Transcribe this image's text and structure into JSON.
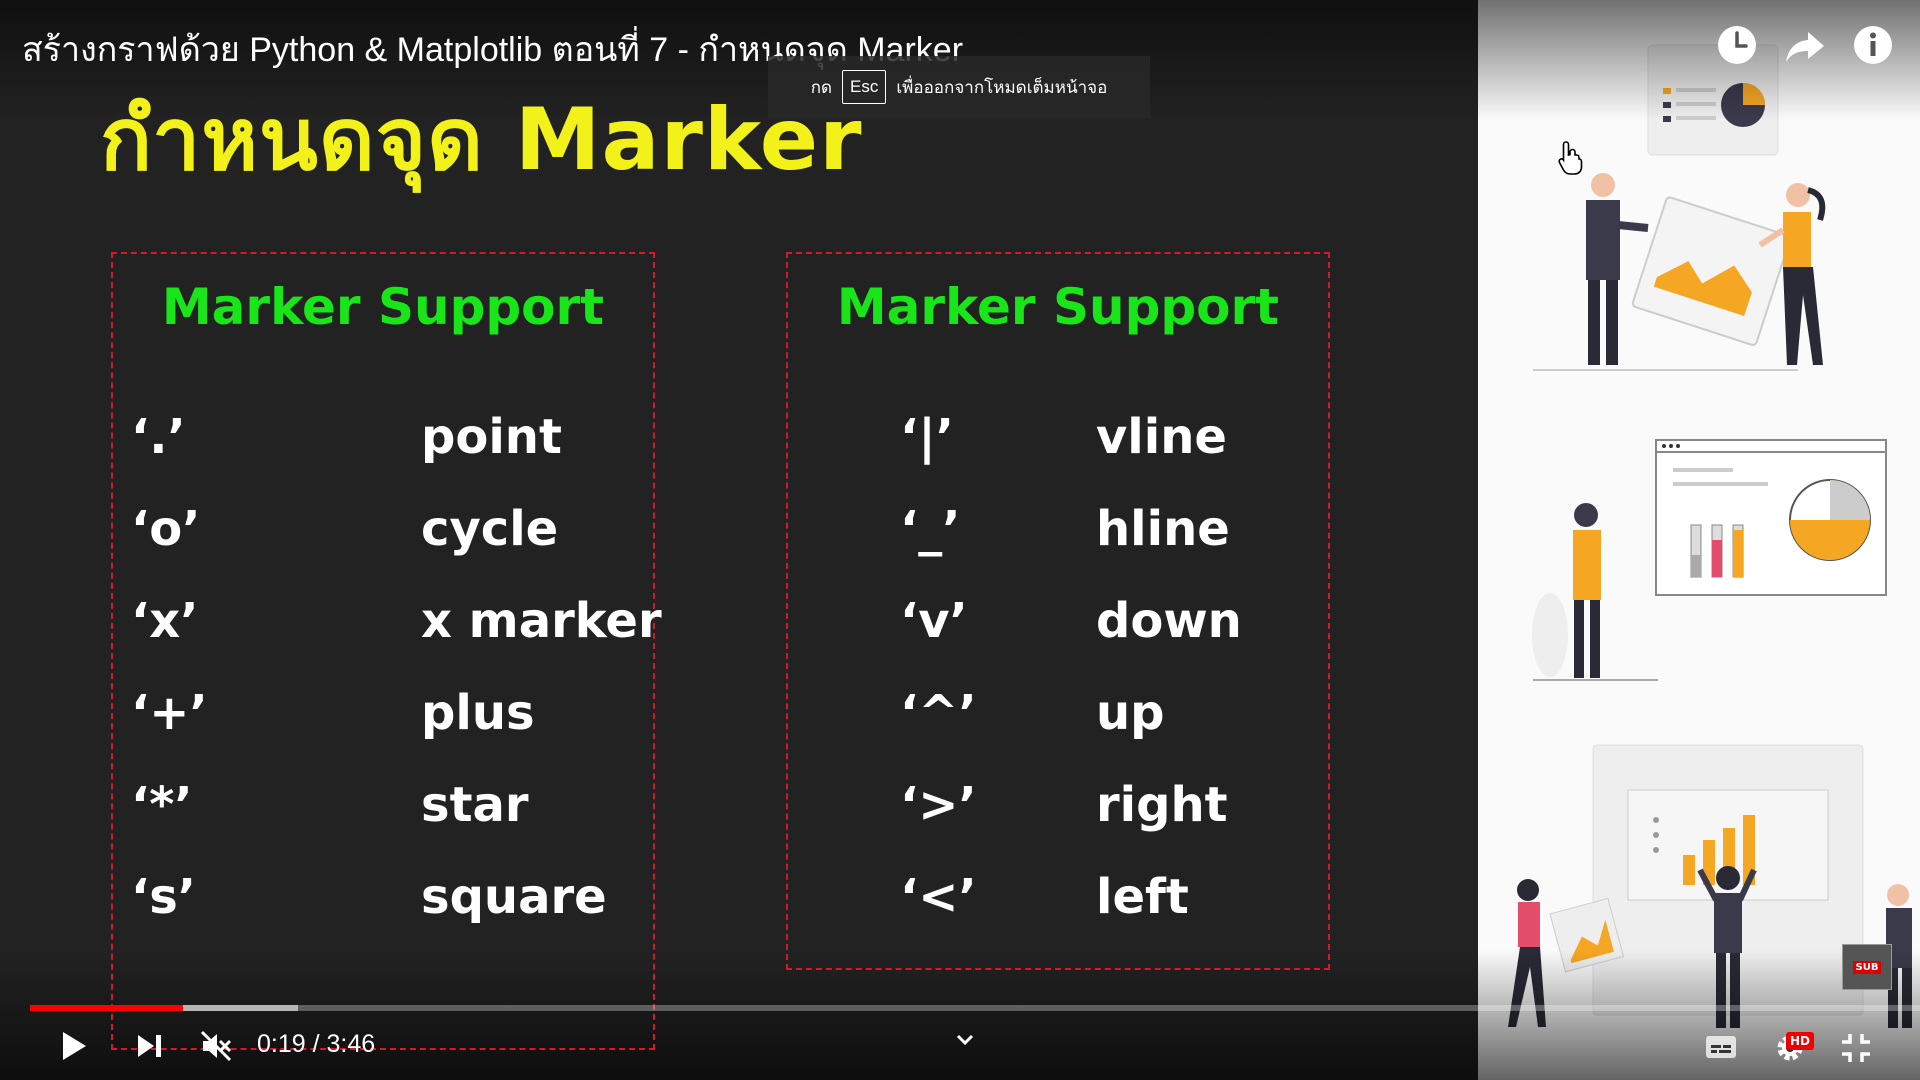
{
  "video": {
    "title": "สร้างกราฟด้วย Python & Matplotlib ตอนที่ 7 - กำหนดจุด Marker",
    "current_time": "0:19",
    "duration": "3:46",
    "time_display": "0:19 / 3:46",
    "progress_played": 0.081,
    "progress_buffered": 0.142
  },
  "fullscreen_tip": {
    "prefix": "กด",
    "key": "Esc",
    "message": "เพื่อออกจากโหมดเต็มหน้าจอ"
  },
  "slide": {
    "heading": "กำหนดจุด Marker",
    "left_box": {
      "title": "Marker Support",
      "rows": [
        {
          "code": "‘.’",
          "label": "point"
        },
        {
          "code": "‘o’",
          "label": "cycle"
        },
        {
          "code": "‘x’",
          "label": "x marker"
        },
        {
          "code": "‘+’",
          "label": "plus"
        },
        {
          "code": "‘*’",
          "label": "star"
        },
        {
          "code": "‘s’",
          "label": "square"
        }
      ]
    },
    "right_box": {
      "title": "Marker Support",
      "rows": [
        {
          "code": "‘|’",
          "label": "vline"
        },
        {
          "code": "‘_’",
          "label": "hline"
        },
        {
          "code": "‘v’",
          "label": "down"
        },
        {
          "code": "‘^’",
          "label": "up"
        },
        {
          "code": "‘>’",
          "label": "right"
        },
        {
          "code": "‘<’",
          "label": "left"
        }
      ]
    }
  },
  "icons": {
    "watch_later": "clock-icon",
    "share": "share-icon",
    "info": "info-icon",
    "play": "play-icon",
    "next": "next-icon",
    "volume": "mute-icon",
    "chevron": "chevron-down-icon",
    "subtitles": "subtitles-icon",
    "settings": "gear-icon",
    "exit_fullscreen": "exit-fullscreen-icon"
  },
  "badges": {
    "hd": "HD",
    "subscribe": "SUB"
  },
  "colors": {
    "heading": "#f2f21a",
    "box_title": "#19e619",
    "box_border": "#d11a2a",
    "progress": "#ff0000",
    "illustration_accent": "#f5a623"
  }
}
